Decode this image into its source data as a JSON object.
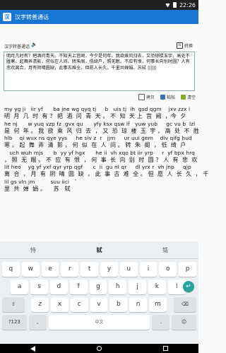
{
  "status": {
    "time": "22:26"
  },
  "app": {
    "title": "汉字转普通话"
  },
  "toolbar": {
    "label": "汉字转普通话",
    "convert_label": "转换"
  },
  "input": {
    "text": "明月几时有？把酒问青天。不知天上宫阙，今夕是何年。我欲乘风归去，又恐琼楼玉宇，高处不胜寒。起舞弄清影，何似在人间。转朱阁，低绮户，照无眠。不应有恨，何事长向别时圆？人有悲欢离合，月有阴晴圆缺，此事古难全。但愿人长久，千里共婵娟。苏轼 ||||||"
  },
  "actions": {
    "copy": "拷贝",
    "paste": "粘帖",
    "clear": "清空"
  },
  "output": {
    "lines": [
      {
        "py": "my yg ji   iir yf      ba jne wg qyq tj     b   uis tj  ih  gsd qgm    jxv zzx i",
        "hz": "明  月  几  时  有 ？ 把  酒  问  青  天 。 不  知  天 上  宫  阙  ，今  夕"
      },
      {
        "py": "he nj      w yuq vzp fz  gvx qu      yfy ksx qsw lf   yuw yub     gc vu b  lzl",
        "hz": "是  何  年 。 我  欲  乘  风  归  去  ， 又  恐  琼  楼  玉  宇 ， 高  处  不  胜"
      },
      {
        "py": "hlb    qi wux ns qye yys     he siv z  r   jjm     ur uui gem    div qifg hud",
        "hz": "寒 。 起  舞  弄  清  影 ， 何  似  在  人  间 。 转  朱  阁  ， 低  绮  户"
      },
      {
        "py": "   uch wuh mjs      b  yy yf hgx      he ii  vh xqo bt iir yrp     r  yf bpx hrq",
        "hz": "， 照  无  眠 。 不  应  有  恨  ， 何  事  长  向  别  时  圆 ？ 人  有  悲  欢"
      },
      {
        "py": "lit heo    yg yf yxf qyr yrp qgf      c  ii  gu nl qr     dl yrx r  vh jnp     qjp",
        "hz": "离  合  ， 月  有  阴  晴  圆  缺  ， 此  事  古  难  全 。 但  愿  人  长  久  ， 千"
      },
      {
        "py": "lil gs vln jm         suu iici   ˇ",
        "hz": "里  共  婵  娟 。    苏   轼"
      }
    ]
  },
  "keyboard": {
    "candidates": [
      "恃",
      "轼",
      "铥"
    ],
    "row1": [
      "q",
      "w",
      "e",
      "r",
      "t",
      "y",
      "u",
      "i",
      "o",
      "p"
    ],
    "row2": [
      "a",
      "s",
      "d",
      "f",
      "g",
      "h",
      "j",
      "k",
      "l"
    ],
    "row3": [
      "z",
      "x",
      "c",
      "v",
      "b",
      "n",
      "m"
    ],
    "fn": {
      "symbols": "?123",
      "comma": ",",
      "space": "中文",
      "period": "."
    }
  },
  "colors": {
    "appbar": "#1976d2",
    "enter": "#26a69a"
  }
}
